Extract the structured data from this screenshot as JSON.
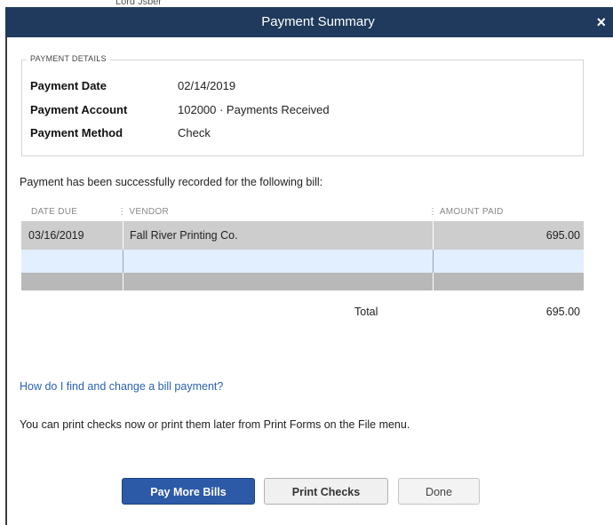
{
  "window": {
    "partial_text": "Lord Jsber",
    "title": "Payment Summary",
    "close_glyph": "×"
  },
  "payment_details": {
    "legend": "PAYMENT DETAILS",
    "rows": [
      {
        "label": "Payment Date",
        "value": "02/14/2019"
      },
      {
        "label": "Payment Account",
        "value": "102000 · Payments Received"
      },
      {
        "label": "Payment Method",
        "value": "Check"
      }
    ]
  },
  "message": "Payment has been successfully recorded for the following bill:",
  "bills_table": {
    "columns": [
      "DATE DUE",
      "VENDOR",
      "AMOUNT PAID"
    ],
    "rows": [
      {
        "date_due": "03/16/2019",
        "vendor": "Fall River Printing Co.",
        "amount_paid": "695.00"
      }
    ],
    "total_label": "Total",
    "total_value": "695.00"
  },
  "help_link": "How do I find and change a bill payment?",
  "print_note": "You can print checks now or print them later from Print Forms on the File menu.",
  "buttons": {
    "pay_more": "Pay More Bills",
    "print_checks": "Print Checks",
    "done": "Done"
  },
  "colors": {
    "titlebar": "#1f3a5c",
    "primary_button": "#2d5aa6",
    "link": "#2b62b4"
  }
}
